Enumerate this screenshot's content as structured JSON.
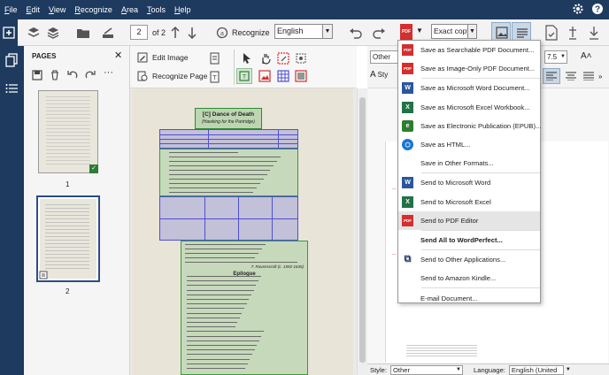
{
  "menu": {
    "items": [
      {
        "key": "F",
        "rest": "ile"
      },
      {
        "key": "E",
        "rest": "dit"
      },
      {
        "key": "V",
        "rest": "iew"
      },
      {
        "key": "R",
        "rest": "ecognize"
      },
      {
        "key": "A",
        "rest": "rea"
      },
      {
        "key": "T",
        "rest": "ools"
      },
      {
        "key": "H",
        "rest": "elp"
      }
    ]
  },
  "toolbar": {
    "page_current": "2",
    "page_of": "of 2",
    "recognize_label": "Recognize",
    "language_value": "English",
    "export_mode": "Exact copy"
  },
  "pages_panel": {
    "title": "PAGES",
    "page1_label": "1",
    "page2_label": "2"
  },
  "image_toolbar": {
    "edit_image": "Edit Image",
    "recognize_page": "Recognize Page"
  },
  "text_toolbar": {
    "style_value": "Other",
    "font_size": "7.5",
    "style_short": "Sty"
  },
  "document": {
    "title_code": "[C]",
    "title": "Dance of Death",
    "subtitle": "(Hawking for the Partridge)",
    "epilogue_heading": "Epilogue",
    "attribution": "T. Ravenscroft (c. 1592-1635)"
  },
  "dropdown": {
    "items": [
      {
        "label": "Save as Searchable PDF Document...",
        "icon": "pdf-icon",
        "color": "#d32f2f"
      },
      {
        "label": "Save as Image-Only PDF Document...",
        "icon": "pdf-icon",
        "color": "#d32f2f"
      },
      {
        "label": "Save as Microsoft Word Document...",
        "icon": "word-icon",
        "color": "#2b579a"
      },
      {
        "label": "Save as Microsoft Excel Workbook...",
        "icon": "excel-icon",
        "color": "#217346"
      },
      {
        "label": "Save as Electronic Publication (EPUB)...",
        "icon": "epub-icon",
        "color": "#2e7d32"
      },
      {
        "label": "Save as HTML...",
        "icon": "html-icon",
        "color": "#1976d2"
      },
      {
        "label": "Save in Other Formats...",
        "icon": "",
        "color": ""
      },
      {
        "label": "Send to Microsoft Word",
        "icon": "word-icon",
        "color": "#2b579a"
      },
      {
        "label": "Send to Microsoft Excel",
        "icon": "excel-icon",
        "color": "#217346"
      },
      {
        "label": "Send to PDF Editor",
        "icon": "pdf-icon",
        "color": "#d32f2f"
      },
      {
        "label": "Send All to WordPerfect...",
        "icon": "",
        "color": ""
      },
      {
        "label": "Send to Other Applications...",
        "icon": "apps-icon",
        "color": "#1e3a5f"
      },
      {
        "label": "Send to Amazon Kindle...",
        "icon": "",
        "color": ""
      },
      {
        "label": "E-mail Document...",
        "icon": "",
        "color": ""
      }
    ]
  },
  "status": {
    "style_label": "Style:",
    "style_value": "Other",
    "language_label": "Language:",
    "language_value": "English (United"
  },
  "colors": {
    "nav": "#1e3a5f",
    "accent": "#2e7d32",
    "table_region": "#5050d0",
    "text_region": "#3a9a3a"
  }
}
